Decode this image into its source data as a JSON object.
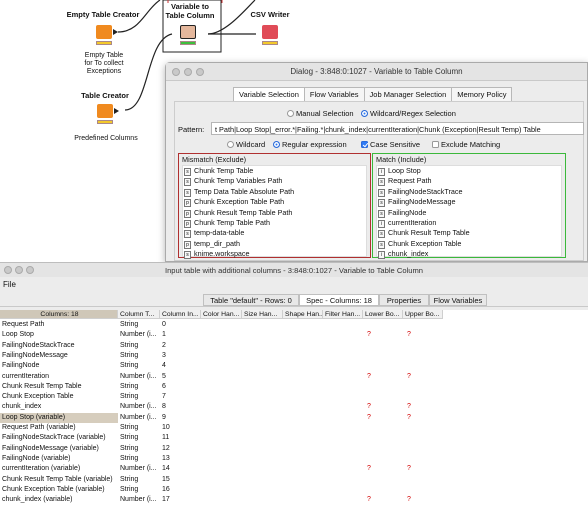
{
  "workflow": {
    "nodes": [
      {
        "title": "Empty Table Creator",
        "desc": [
          "Empty Table",
          "for To collect",
          "Exceptions"
        ]
      },
      {
        "title": "Variable to\nTable Column",
        "desc": []
      },
      {
        "title": "CSV Writer",
        "desc": []
      },
      {
        "title": "Table Creator",
        "desc": [
          "Predefined Columns"
        ]
      }
    ],
    "node_title_variable_line1": "Variable to",
    "node_title_variable_line2": "Table Column"
  },
  "dialog": {
    "title": "Dialog - 3:848:0:1027 - Variable to Table Column",
    "tabs": [
      "Variable Selection",
      "Flow Variables",
      "Job Manager Selection",
      "Memory Policy"
    ],
    "active_tab": "Variable Selection",
    "mode_manual": "Manual Selection",
    "mode_wildcard": "Wildcard/Regex Selection",
    "pattern_label": "Pattern:",
    "pattern_value": "t Path|Loop Stop|_error.*|Failing.*|chunk_index|currentIteration|Chunk (Exception|Result Temp) Table",
    "opt_wildcard": "Wildcard",
    "opt_regex": "Regular expression",
    "opt_case": "Case Sensitive",
    "opt_exclude": "Exclude Matching",
    "mismatch_title": "Mismatch (Exclude)",
    "mismatch_items": [
      {
        "type": "s",
        "name": "Chunk Temp Table"
      },
      {
        "type": "s",
        "name": "Chunk Temp Variables Path"
      },
      {
        "type": "s",
        "name": "Temp Data Table Absolute Path"
      },
      {
        "type": "p",
        "name": "Chunk Exception Table Path"
      },
      {
        "type": "p",
        "name": "Chunk Result Temp Table Path"
      },
      {
        "type": "p",
        "name": "Chunk Temp Table Path"
      },
      {
        "type": "s",
        "name": "temp-data-table"
      },
      {
        "type": "p",
        "name": "temp_dir_path"
      },
      {
        "type": "s",
        "name": "knime.workspace"
      }
    ],
    "match_title": "Match (Include)",
    "match_items": [
      {
        "type": "i",
        "name": "Loop Stop"
      },
      {
        "type": "s",
        "name": "Request Path"
      },
      {
        "type": "s",
        "name": "FailingNodeStackTrace"
      },
      {
        "type": "s",
        "name": "FailingNodeMessage"
      },
      {
        "type": "s",
        "name": "FailingNode"
      },
      {
        "type": "i",
        "name": "currentIteration"
      },
      {
        "type": "s",
        "name": "Chunk Result Temp Table"
      },
      {
        "type": "s",
        "name": "Chunk Exception Table"
      },
      {
        "type": "i",
        "name": "chunk_index"
      }
    ],
    "colors": {
      "mismatch": "#b03030",
      "match": "#3bb83b",
      "accent": "#2f7bf5"
    }
  },
  "table_view": {
    "title": "Input table with additional columns - 3:848:0:1027 - Variable to Table Column",
    "menu_file": "File",
    "tabs": [
      "Table \"default\" - Rows: 0",
      "Spec - Columns: 18",
      "Properties",
      "Flow Variables"
    ],
    "active_tab": "Spec - Columns: 18",
    "headers": [
      "Columns: 18",
      "Column T...",
      "Column In...",
      "Color Han...",
      "Size Han...",
      "Shape Han...",
      "Filter Han...",
      "Lower Bo...",
      "Upper Bo..."
    ],
    "rows": [
      {
        "name": "Request Path",
        "type": "String",
        "index": "0"
      },
      {
        "name": "Loop Stop",
        "type": "Number (i...",
        "index": "1"
      },
      {
        "name": "FailingNodeStackTrace",
        "type": "String",
        "index": "2"
      },
      {
        "name": "FailingNodeMessage",
        "type": "String",
        "index": "3"
      },
      {
        "name": "FailingNode",
        "type": "String",
        "index": "4"
      },
      {
        "name": "currentIteration",
        "type": "Number (i...",
        "index": "5"
      },
      {
        "name": "Chunk Result Temp Table",
        "type": "String",
        "index": "6"
      },
      {
        "name": "Chunk Exception Table",
        "type": "String",
        "index": "7"
      },
      {
        "name": "chunk_index",
        "type": "Number (i...",
        "index": "8"
      },
      {
        "name": "Loop Stop (variable)",
        "type": "Number (i...",
        "index": "9"
      },
      {
        "name": "Request Path (variable)",
        "type": "String",
        "index": "10"
      },
      {
        "name": "FailingNodeStackTrace (variable)",
        "type": "String",
        "index": "11"
      },
      {
        "name": "FailingNodeMessage (variable)",
        "type": "String",
        "index": "12"
      },
      {
        "name": "FailingNode (variable)",
        "type": "String",
        "index": "13"
      },
      {
        "name": "currentIteration (variable)",
        "type": "Number (i...",
        "index": "14"
      },
      {
        "name": "Chunk Result Temp Table (variable)",
        "type": "String",
        "index": "15"
      },
      {
        "name": "Chunk Exception Table (variable)",
        "type": "String",
        "index": "16"
      },
      {
        "name": "chunk_index (variable)",
        "type": "Number (i...",
        "index": "17"
      }
    ],
    "selected_row": 9,
    "missing_marker": "?",
    "qmark_rows": [
      1,
      5,
      8,
      9,
      14,
      17
    ]
  }
}
